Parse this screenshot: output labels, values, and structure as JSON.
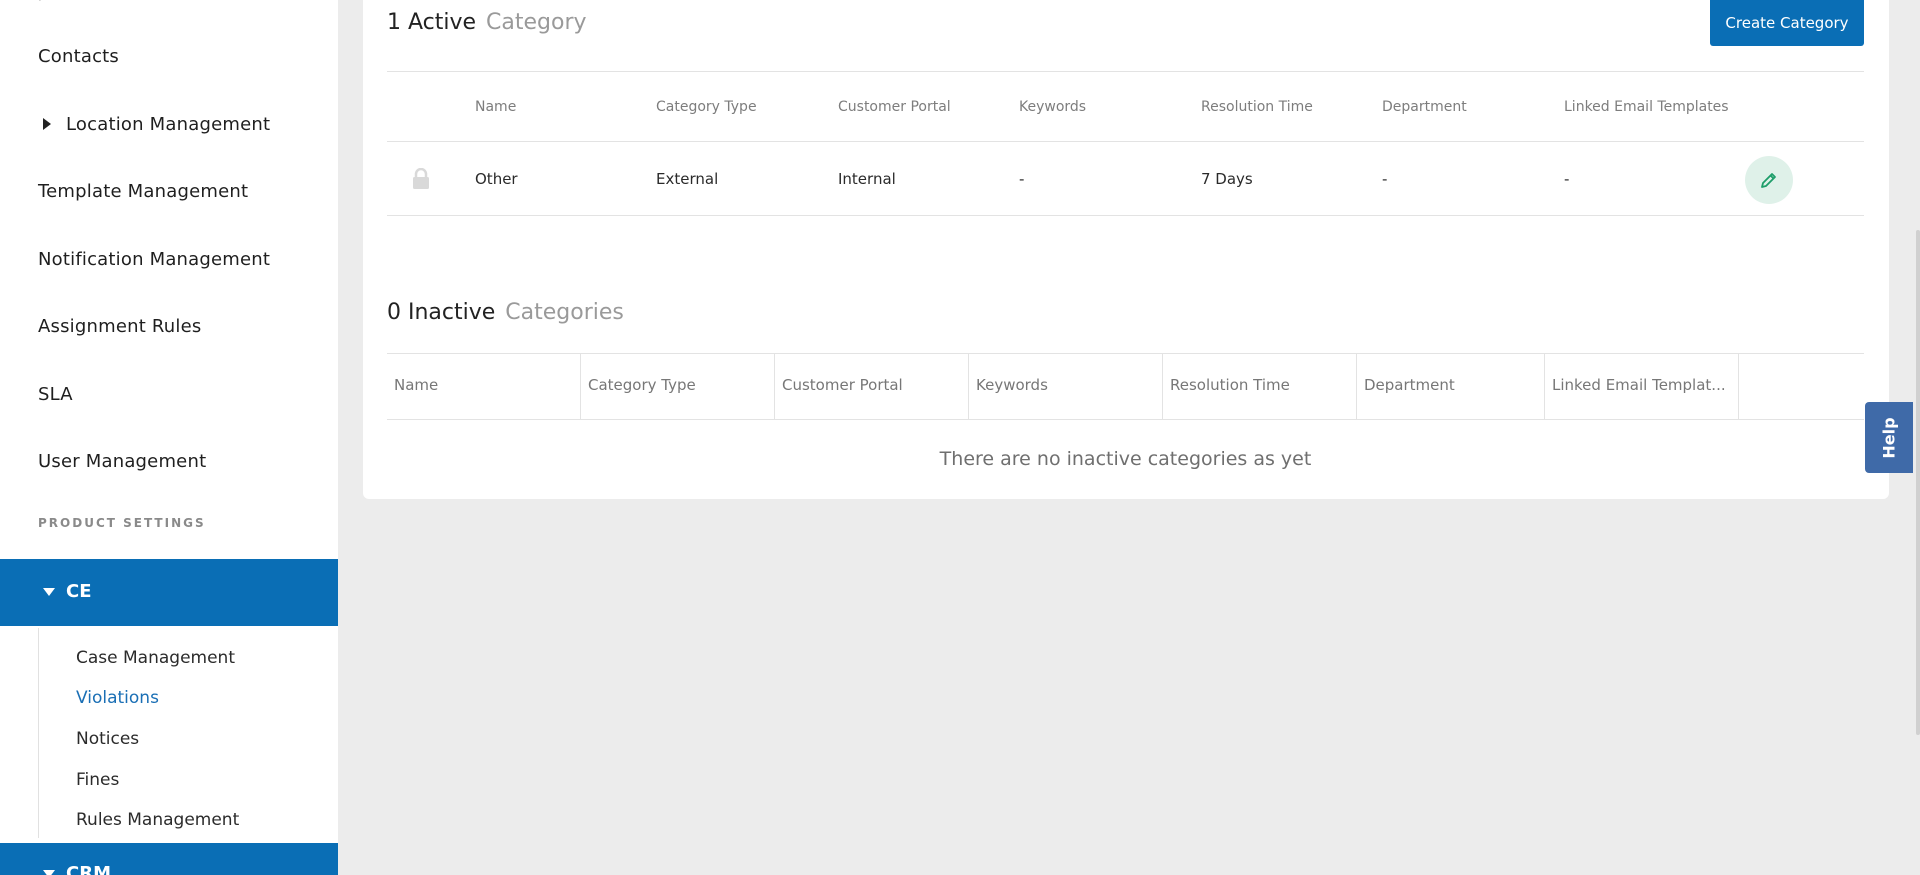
{
  "sidebar": {
    "items": [
      {
        "label": "Contacts"
      },
      {
        "label": "Location Management"
      },
      {
        "label": "Template Management"
      },
      {
        "label": "Notification Management"
      },
      {
        "label": "Assignment Rules"
      },
      {
        "label": "SLA"
      },
      {
        "label": "User Management"
      }
    ],
    "section_label": "PRODUCT SETTINGS",
    "active_group": "CE",
    "sub_items": [
      {
        "label": "Case Management"
      },
      {
        "label": "Violations"
      },
      {
        "label": "Notices"
      },
      {
        "label": "Fines"
      },
      {
        "label": "Rules Management"
      }
    ],
    "next_group": "CRM"
  },
  "active": {
    "count": "1 Active",
    "noun": "Category",
    "create_button": "Create Category",
    "headers": [
      "Name",
      "Category Type",
      "Customer Portal",
      "Keywords",
      "Resolution Time",
      "Department",
      "Linked Email Templates"
    ],
    "rows": [
      {
        "cells": [
          "Other",
          "External",
          "Internal",
          "-",
          "7 Days",
          "-",
          "-"
        ]
      }
    ]
  },
  "inactive": {
    "count": "0 Inactive",
    "noun": "Categories",
    "headers": [
      "Name",
      "Category Type",
      "Customer Portal",
      "Keywords",
      "Resolution Time",
      "Department",
      "Linked Email Templat..."
    ],
    "empty_message": "There are no inactive categories as yet"
  },
  "help": {
    "label": "Help"
  },
  "colors": {
    "primary": "#0a6eb5",
    "edit_bg": "#dff1e9",
    "edit_icon": "#1e9e6a",
    "help_bg": "#3f6aa8"
  }
}
